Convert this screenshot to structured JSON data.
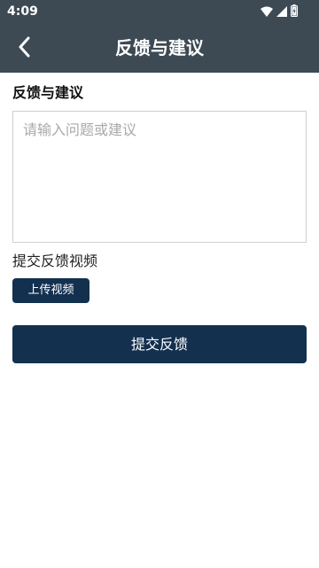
{
  "status_bar": {
    "time": "4:09",
    "icons": [
      "wifi-icon",
      "signal-icon",
      "battery-charging-icon"
    ]
  },
  "app_bar": {
    "back_icon": "chevron-left-icon",
    "title": "反馈与建议"
  },
  "form": {
    "section_title": "反馈与建议",
    "feedback_placeholder": "请输入问题或建议",
    "feedback_value": "",
    "video_label": "提交反馈视频",
    "upload_button_label": "上传视频",
    "submit_button_label": "提交反馈"
  },
  "colors": {
    "app_bar_bg": "#3d4a54",
    "button_bg": "#13304f",
    "input_border": "#cfcfcf",
    "placeholder": "#a9a9a9"
  }
}
